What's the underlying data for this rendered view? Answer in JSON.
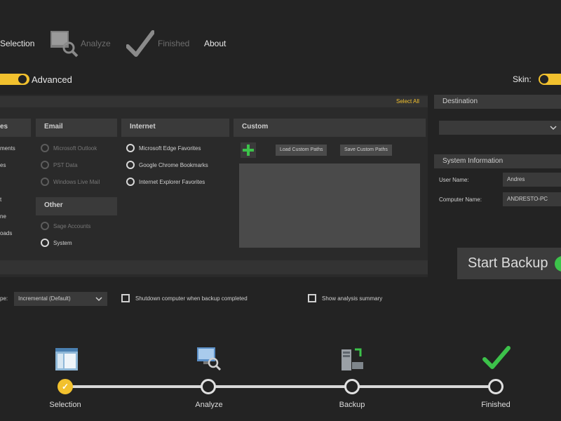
{
  "nav": {
    "items": [
      {
        "label": "Selection",
        "state": "active"
      },
      {
        "label": "Analyze",
        "state": "disabled"
      },
      {
        "label": "Finished",
        "state": "disabled"
      },
      {
        "label": "About",
        "state": "active"
      }
    ]
  },
  "mode": {
    "advanced_label": "Advanced",
    "skin_label": "Skin:"
  },
  "select_all": "Select All",
  "columns": {
    "first": {
      "title": "es",
      "items": [
        "ments",
        "es",
        "",
        "t",
        "ne",
        "oads"
      ]
    },
    "email": {
      "title": "Email",
      "items": [
        "Microsoft Outlook",
        "PST Data",
        "Windows Live Mail"
      ]
    },
    "other": {
      "title": "Other",
      "items": [
        "Sage Accounts",
        "System"
      ]
    },
    "internet": {
      "title": "Internet",
      "items": [
        "Microsoft Edge Favorites",
        "Google Chrome Bookmarks",
        "Internet Explorer Favorites"
      ]
    },
    "custom": {
      "title": "Custom",
      "load_label": "Load Custom Paths",
      "save_label": "Save Custom Paths",
      "add_icon": "plus-icon"
    }
  },
  "destination": {
    "title": "Destination",
    "value": ""
  },
  "system_info": {
    "title": "System Information",
    "user_label": "User Name:",
    "user_value": "Andres",
    "computer_label": "Computer Name:",
    "computer_value": "ANDRESTO-PC"
  },
  "start_backup": "Start Backup",
  "options": {
    "type_label": "pe:",
    "type_value": "Incremental (Default)",
    "shutdown_label": "Shutdown computer when backup completed",
    "summary_label": "Show analysis summary"
  },
  "steps": [
    {
      "label": "Selection",
      "state": "done",
      "icon": "window-icon"
    },
    {
      "label": "Analyze",
      "state": "pending",
      "icon": "monitor-magnifier-icon"
    },
    {
      "label": "Backup",
      "state": "pending",
      "icon": "server-icon"
    },
    {
      "label": "Finished",
      "state": "pending",
      "icon": "checkmark-icon"
    }
  ],
  "colors": {
    "accent": "#f2c12e",
    "bg": "#232323",
    "panel": "#3a3a3a",
    "green": "#3cc24a"
  }
}
